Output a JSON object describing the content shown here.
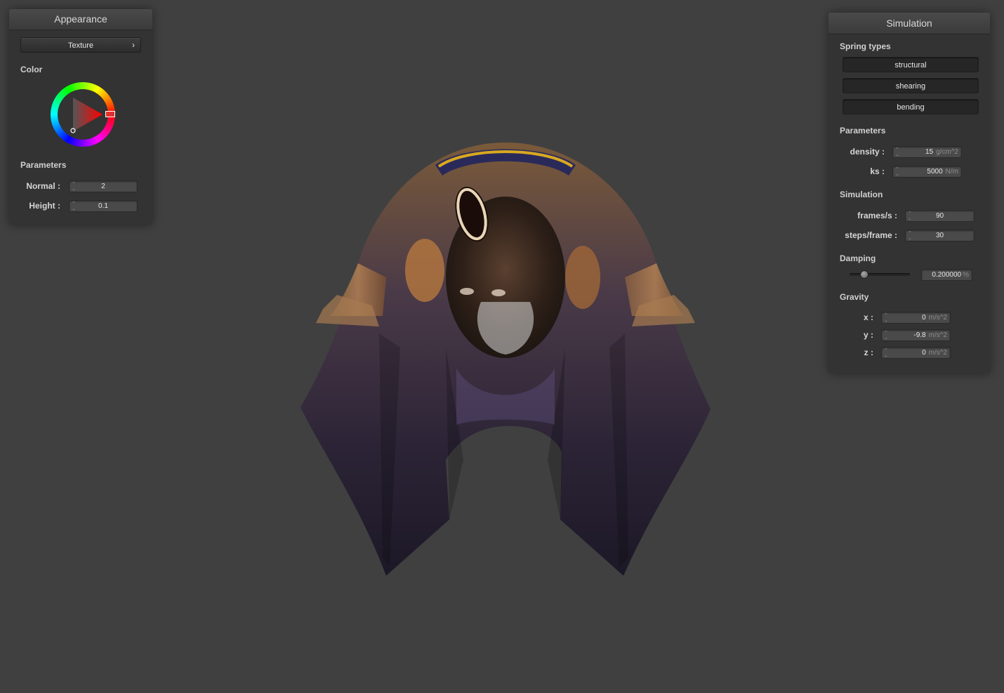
{
  "appearance": {
    "title": "Appearance",
    "texture_button": "Texture",
    "chevron": "›",
    "color_label": "Color",
    "color_wheel_icon": "color-wheel-icon",
    "selected_hue": "#ff0000",
    "parameters_label": "Parameters",
    "normal": {
      "label": "Normal :",
      "value": "2"
    },
    "height": {
      "label": "Height :",
      "value": "0.1"
    }
  },
  "simulation": {
    "title": "Simulation",
    "spring_types_label": "Spring types",
    "spring_types": [
      "structural",
      "shearing",
      "bending"
    ],
    "parameters_label": "Parameters",
    "density": {
      "label": "density :",
      "value": "15",
      "unit": "g/cm^2"
    },
    "ks": {
      "label": "ks :",
      "value": "5000",
      "unit": "N/m"
    },
    "simulation_label": "Simulation",
    "frames_per_s": {
      "label": "frames/s :",
      "value": "90"
    },
    "steps_per_frame": {
      "label": "steps/frame :",
      "value": "30"
    },
    "damping_label": "Damping",
    "damping": {
      "value": "0.200000",
      "unit": "%",
      "slider_fraction": 0.2
    },
    "gravity_label": "Gravity",
    "gravity": {
      "x": {
        "label": "x :",
        "value": "0",
        "unit": "m/s^2"
      },
      "y": {
        "label": "y :",
        "value": "-9.8",
        "unit": "m/s^2"
      },
      "z": {
        "label": "z :",
        "value": "0",
        "unit": "m/s^2"
      }
    }
  },
  "viewport": {
    "background": "#404040",
    "object": "textured-cloth-draped-over-sphere"
  }
}
